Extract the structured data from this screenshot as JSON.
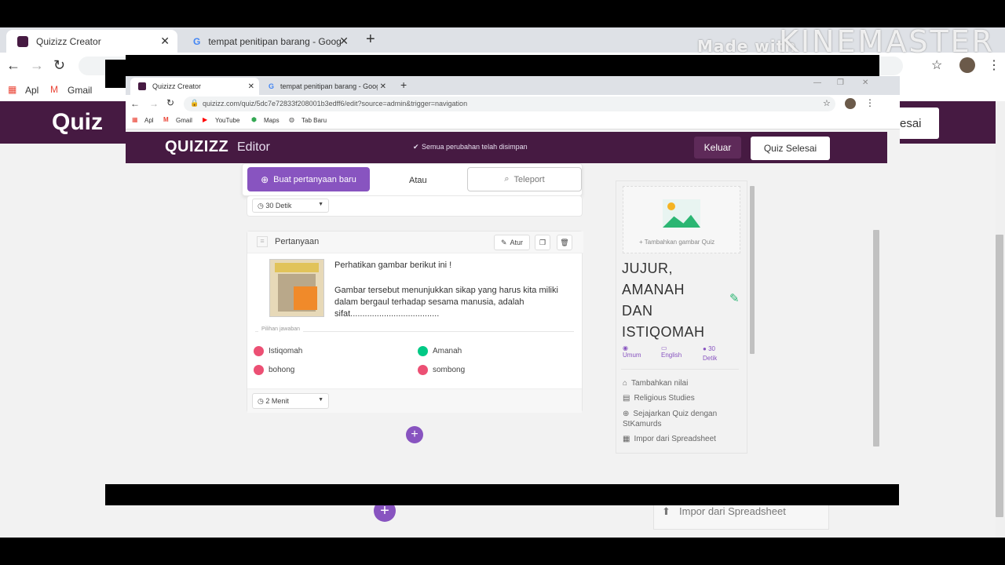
{
  "outer_browser": {
    "tabs": [
      {
        "label": "Quizizz Creator"
      },
      {
        "label": "tempat penitipan barang - Goog"
      }
    ],
    "bookmarks": [
      "Apl",
      "Gmail"
    ],
    "partial_logo": "Quiz",
    "partial_button": "esai",
    "bottom_link": "Impor dari Spreadsheet"
  },
  "watermark": {
    "made_with": "Made with",
    "brand": "KINEMASTER"
  },
  "inner_browser": {
    "tabs": [
      {
        "label": "Quizizz Creator"
      },
      {
        "label": "tempat penitipan barang - Goog"
      }
    ],
    "url": "quizizz.com/quiz/5dc7e72833f208001b3edff6/edit?source=admin&trigger=navigation",
    "bookmarks": [
      "Apl",
      "Gmail",
      "YouTube",
      "Maps",
      "Tab Baru"
    ]
  },
  "header": {
    "logo": "QUIZIZZ",
    "editor": "Editor",
    "saved_status": "Semua perubahan telah disimpan",
    "exit_label": "Keluar",
    "finish_label": "Quiz Selesai"
  },
  "create_bar": {
    "new_question": "Buat pertanyaan baru",
    "or": "Atau",
    "teleport": "Teleport"
  },
  "prev_question": {
    "timer": "30 Detik"
  },
  "question": {
    "type": "Pertanyaan",
    "edit_label": "Atur",
    "line1": "Perhatikan gambar berikut ini !",
    "line2": "Gambar tersebut menunjukkan sikap yang harus kita miliki dalam bergaul terhadap sesama manusia, adalah sifat.....................................",
    "answers_label": "Pilihan jawaban",
    "answers": [
      {
        "text": "Istiqomah",
        "correct": false
      },
      {
        "text": "Amanah",
        "correct": true
      },
      {
        "text": "bohong",
        "correct": false
      },
      {
        "text": "sombong",
        "correct": false
      }
    ],
    "timer": "2 Menit"
  },
  "sidebar": {
    "add_image": "+ Tambahkan gambar Quiz",
    "title": "JUJUR, AMANAH DAN ISTIQOMAH",
    "meta": [
      {
        "label": "Umum"
      },
      {
        "label": "English"
      },
      {
        "label": "30 Detik"
      }
    ],
    "links": [
      "Tambahkan nilai",
      "Religious Studies",
      "Sejajarkan Quiz dengan StKamurds",
      "Impor dari Spreadsheet"
    ]
  },
  "colors": {
    "header": "#461a42",
    "primary": "#8854c0",
    "correct": "#00c985",
    "incorrect": "#ec5074"
  }
}
